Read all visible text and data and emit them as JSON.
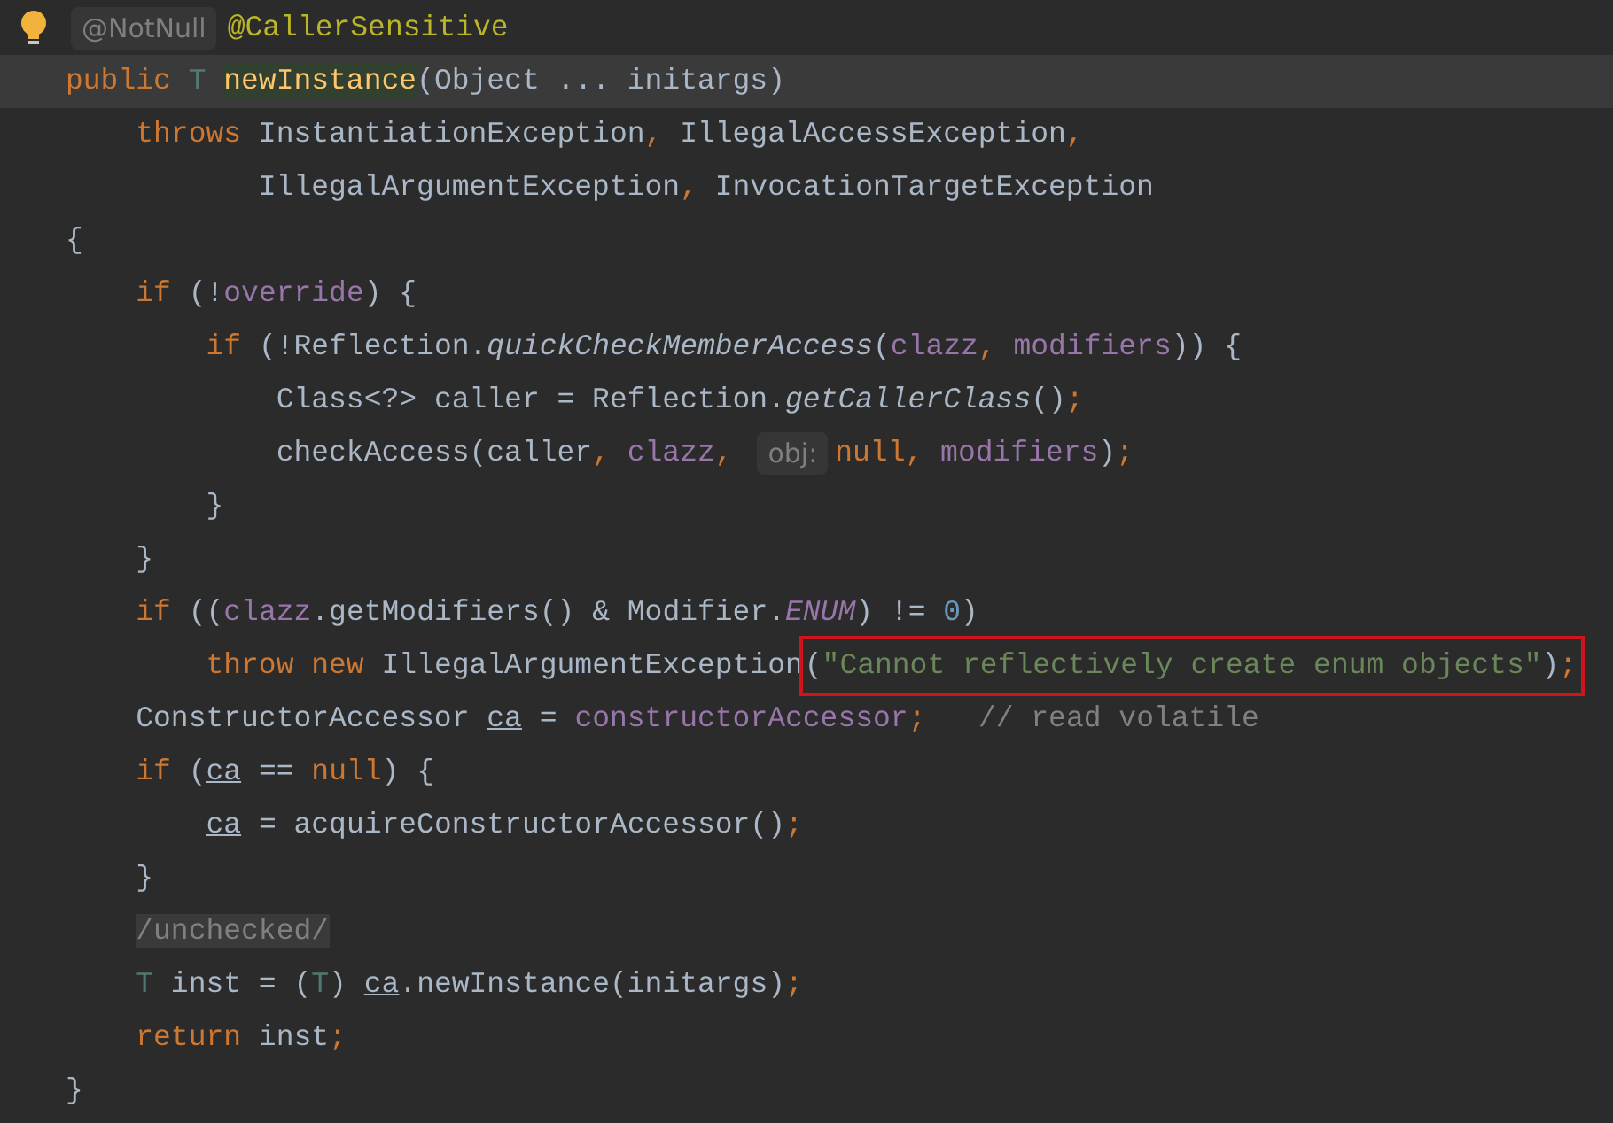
{
  "editor": {
    "lines": [
      {
        "current": false,
        "intention_bulb": true,
        "tokens": [
          {
            "kind": "hint",
            "text": "@NotNull"
          },
          {
            "kind": "annot",
            "text": "@CallerSensitive"
          }
        ]
      },
      {
        "current": true,
        "tokens": [
          {
            "kind": "kw",
            "text": "public "
          },
          {
            "kind": "tparam",
            "text": "T "
          },
          {
            "kind": "decl",
            "text": "newInstance"
          },
          {
            "kind": "text",
            "text": "(Object ... initargs)"
          }
        ]
      },
      {
        "current": false,
        "tokens": [
          {
            "kind": "kw",
            "text": "    throws "
          },
          {
            "kind": "text",
            "text": "InstantiationException"
          },
          {
            "kind": "kw",
            "text": ", "
          },
          {
            "kind": "text",
            "text": "IllegalAccessException"
          },
          {
            "kind": "kw",
            "text": ","
          }
        ]
      },
      {
        "current": false,
        "tokens": [
          {
            "kind": "text",
            "text": "           IllegalArgumentException"
          },
          {
            "kind": "kw",
            "text": ", "
          },
          {
            "kind": "text",
            "text": "InvocationTargetException"
          }
        ]
      },
      {
        "current": false,
        "tokens": [
          {
            "kind": "text",
            "text": "{"
          }
        ]
      },
      {
        "current": false,
        "tokens": [
          {
            "kind": "kw",
            "text": "    if "
          },
          {
            "kind": "text",
            "text": "(!"
          },
          {
            "kind": "field",
            "text": "override"
          },
          {
            "kind": "text",
            "text": ") {"
          }
        ]
      },
      {
        "current": false,
        "tokens": [
          {
            "kind": "kw",
            "text": "        if "
          },
          {
            "kind": "text",
            "text": "(!Reflection."
          },
          {
            "kind": "static",
            "text": "quickCheckMemberAccess"
          },
          {
            "kind": "text",
            "text": "("
          },
          {
            "kind": "field",
            "text": "clazz"
          },
          {
            "kind": "kw",
            "text": ", "
          },
          {
            "kind": "field",
            "text": "modifiers"
          },
          {
            "kind": "text",
            "text": ")) {"
          }
        ]
      },
      {
        "current": false,
        "tokens": [
          {
            "kind": "text",
            "text": "            Class<?> caller = Reflection."
          },
          {
            "kind": "static",
            "text": "getCallerClass"
          },
          {
            "kind": "text",
            "text": "()"
          },
          {
            "kind": "kw",
            "text": ";"
          }
        ]
      },
      {
        "current": false,
        "tokens": [
          {
            "kind": "text",
            "text": "            checkAccess(caller"
          },
          {
            "kind": "kw",
            "text": ", "
          },
          {
            "kind": "field",
            "text": "clazz"
          },
          {
            "kind": "kw",
            "text": ", "
          },
          {
            "kind": "hint",
            "text": "obj:"
          },
          {
            "kind": "kw",
            "text": "null, "
          },
          {
            "kind": "field",
            "text": "modifiers"
          },
          {
            "kind": "text",
            "text": ")"
          },
          {
            "kind": "kw",
            "text": ";"
          }
        ]
      },
      {
        "current": false,
        "tokens": [
          {
            "kind": "text",
            "text": "        }"
          }
        ]
      },
      {
        "current": false,
        "tokens": [
          {
            "kind": "text",
            "text": "    }"
          }
        ]
      },
      {
        "current": false,
        "tokens": [
          {
            "kind": "kw",
            "text": "    if "
          },
          {
            "kind": "text",
            "text": "(("
          },
          {
            "kind": "field",
            "text": "clazz"
          },
          {
            "kind": "text",
            "text": ".getModifiers() & Modifier."
          },
          {
            "kind": "sfield",
            "text": "ENUM"
          },
          {
            "kind": "text",
            "text": ") != "
          },
          {
            "kind": "num",
            "text": "0"
          },
          {
            "kind": "text",
            "text": ")"
          }
        ]
      },
      {
        "current": false,
        "tokens": [
          {
            "kind": "kw",
            "text": "        throw new "
          },
          {
            "kind": "text",
            "text": "IllegalArgumentException"
          },
          {
            "kind": "group",
            "tokens": [
              {
                "kind": "text",
                "text": "("
              },
              {
                "kind": "str",
                "text": "\"Cannot reflectively create enum objects\""
              },
              {
                "kind": "text",
                "text": ")"
              },
              {
                "kind": "kw",
                "text": ";"
              }
            ]
          }
        ]
      },
      {
        "current": false,
        "tokens": [
          {
            "kind": "text",
            "text": "    ConstructorAccessor "
          },
          {
            "kind": "local",
            "text": "ca"
          },
          {
            "kind": "text",
            "text": " = "
          },
          {
            "kind": "field",
            "text": "constructorAccessor"
          },
          {
            "kind": "kw",
            "text": ";"
          },
          {
            "kind": "comment",
            "text": "   // read volatile"
          }
        ]
      },
      {
        "current": false,
        "tokens": [
          {
            "kind": "kw",
            "text": "    if "
          },
          {
            "kind": "text",
            "text": "("
          },
          {
            "kind": "local",
            "text": "ca"
          },
          {
            "kind": "text",
            "text": " == "
          },
          {
            "kind": "kw",
            "text": "null"
          },
          {
            "kind": "text",
            "text": ") {"
          }
        ]
      },
      {
        "current": false,
        "tokens": [
          {
            "kind": "local",
            "text": "        ca"
          },
          {
            "kind": "text",
            "text": " = acquireConstructorAccessor()"
          },
          {
            "kind": "kw",
            "text": ";"
          }
        ]
      },
      {
        "current": false,
        "tokens": [
          {
            "kind": "text",
            "text": "    }"
          }
        ]
      },
      {
        "current": false,
        "tokens": [
          {
            "kind": "folded",
            "text": "    /unchecked/"
          }
        ]
      },
      {
        "current": false,
        "tokens": [
          {
            "kind": "tparam",
            "text": "    T"
          },
          {
            "kind": "text",
            "text": " inst = ("
          },
          {
            "kind": "tparam",
            "text": "T"
          },
          {
            "kind": "text",
            "text": ") "
          },
          {
            "kind": "local",
            "text": "ca"
          },
          {
            "kind": "text",
            "text": ".newInstance(initargs)"
          },
          {
            "kind": "kw",
            "text": ";"
          }
        ]
      },
      {
        "current": false,
        "tokens": [
          {
            "kind": "kw",
            "text": "    return "
          },
          {
            "kind": "text",
            "text": "inst"
          },
          {
            "kind": "kw",
            "text": ";"
          }
        ]
      },
      {
        "current": false,
        "tokens": [
          {
            "kind": "text",
            "text": "}"
          }
        ]
      }
    ]
  }
}
